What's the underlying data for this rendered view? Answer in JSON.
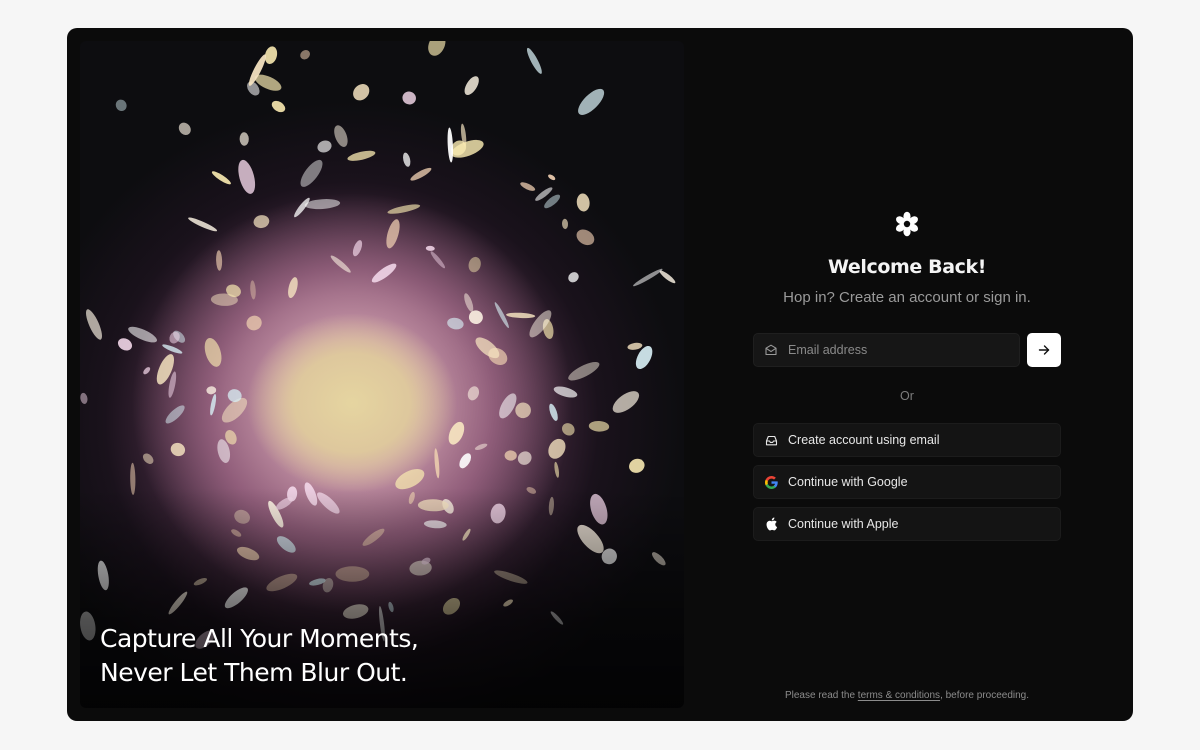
{
  "hero": {
    "tagline_line1": "Capture All Your Moments,",
    "tagline_line2": "Never Let Them Blur Out."
  },
  "auth": {
    "logo_icon": "flower-gear-icon",
    "title": "Welcome Back!",
    "subtitle": "Hop in? Create an account or sign in.",
    "email_placeholder": "Email address",
    "email_value": "",
    "submit_icon": "arrow-right-icon",
    "divider": "Or",
    "options": [
      {
        "label": "Create account using email",
        "icon": "inbox-icon"
      },
      {
        "label": "Continue with Google",
        "icon": "google-icon"
      },
      {
        "label": "Continue with Apple",
        "icon": "apple-icon"
      }
    ],
    "legal_prefix": "Please read the ",
    "legal_link": "terms & conditions",
    "legal_suffix": ", before proceeding."
  },
  "colors": {
    "page_bg": "#f6f6f6",
    "frame_bg": "#0b0b0b",
    "primary_button": "#ffffff",
    "muted_text": "#9a9a9a"
  }
}
